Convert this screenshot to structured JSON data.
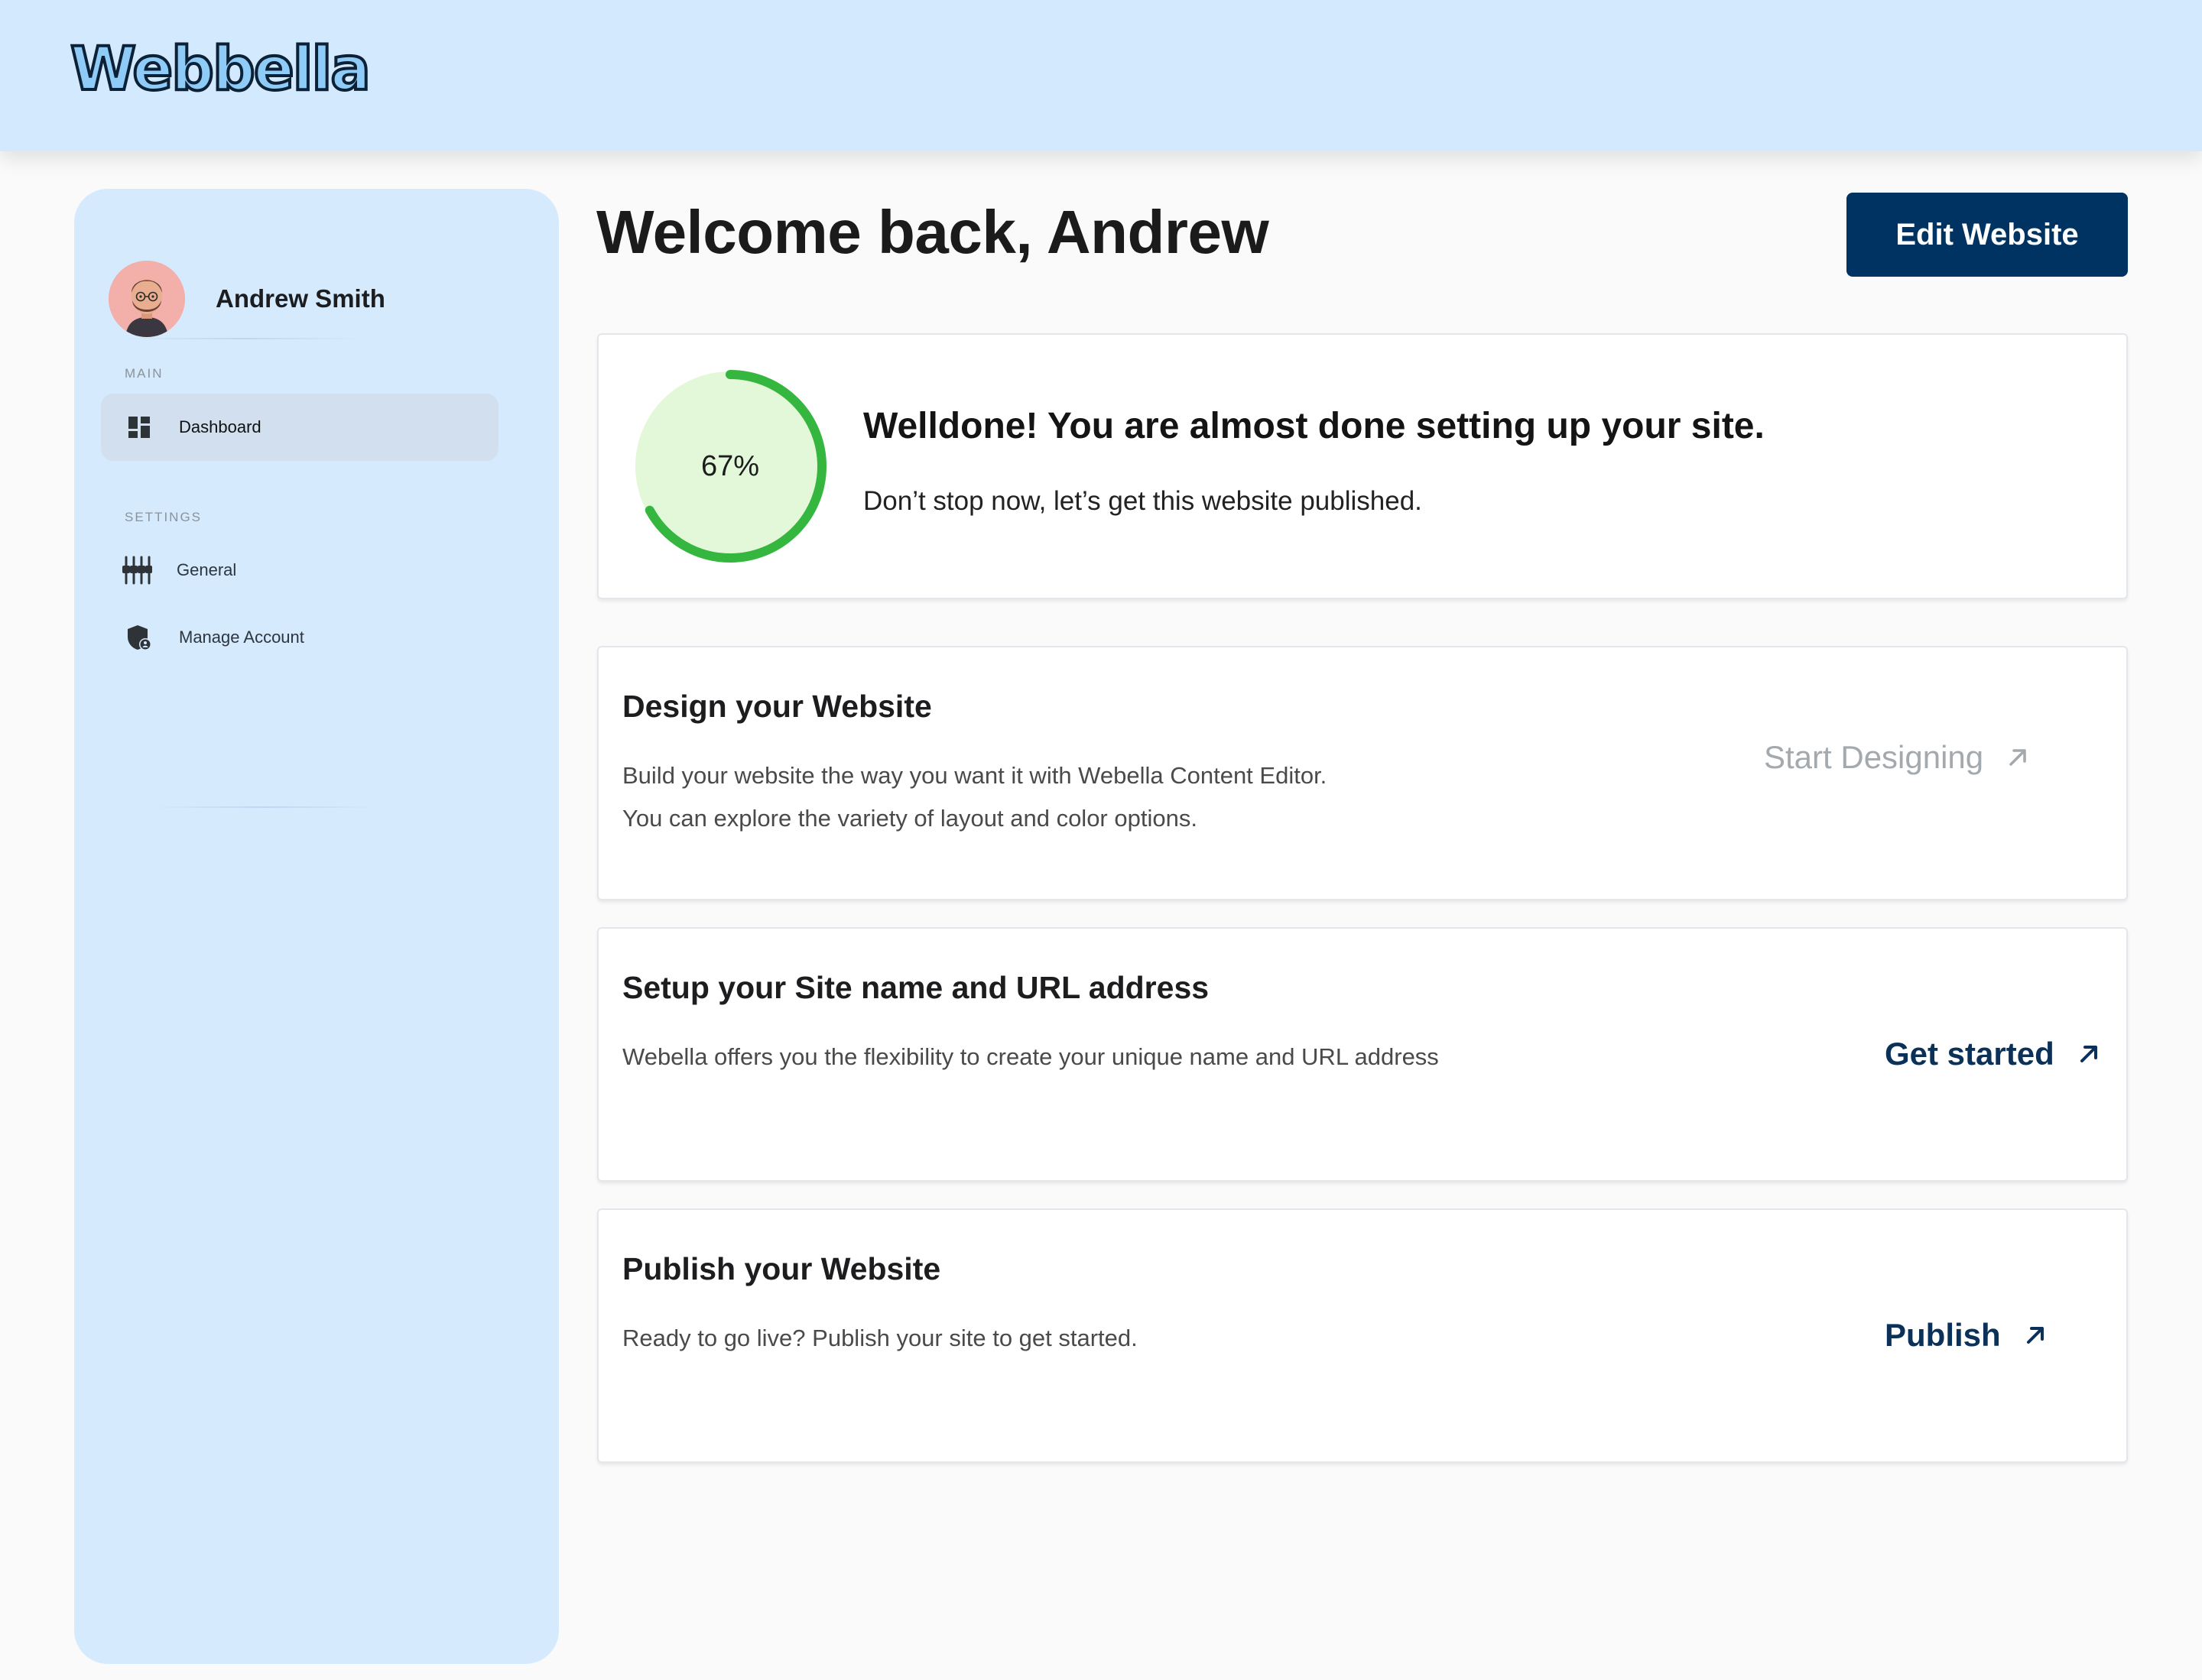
{
  "brand": {
    "logo_text": "Webbella"
  },
  "user": {
    "name": "Andrew Smith"
  },
  "sidebar": {
    "main_label": "MAIN",
    "settings_label": "SETTINGS",
    "items": [
      {
        "label": "Dashboard",
        "icon": "dashboard-icon",
        "active": true
      },
      {
        "label": "General",
        "icon": "sliders-icon",
        "active": false
      },
      {
        "label": "Manage Account",
        "icon": "shield-user-icon",
        "active": false
      }
    ]
  },
  "header": {
    "welcome": "Welcome back, Andrew",
    "edit_button": "Edit Website"
  },
  "progress": {
    "percent_value": 67,
    "percent_label": "67%",
    "title": "Welldone! You are almost done setting up your site.",
    "subtitle": "Don’t stop now, let’s get this website published.",
    "colors": {
      "track": "#e2f8d8",
      "fill": "#35b63e"
    }
  },
  "tasks": [
    {
      "title": "Design your Website",
      "desc_line1": "Build your website the way you want it with Webella Content Editor.",
      "desc_line2": "You can explore the variety of layout and color options.",
      "link": "Start Designing",
      "link_state": "disabled"
    },
    {
      "title": "Setup your Site name and URL address",
      "desc_line1": "Webella offers you the flexibility to create your unique name and URL address",
      "link": "Get started",
      "link_state": "enabled"
    },
    {
      "title": "Publish your Website",
      "desc_line1": "Ready to go live? Publish your site to get started.",
      "link": "Publish",
      "link_state": "enabled"
    }
  ],
  "colors": {
    "header_bg": "#d3e9fd",
    "sidebar_bg": "#d5eafd",
    "primary": "#003361",
    "link": "#0b3159",
    "link_muted": "#a4a9ae"
  }
}
